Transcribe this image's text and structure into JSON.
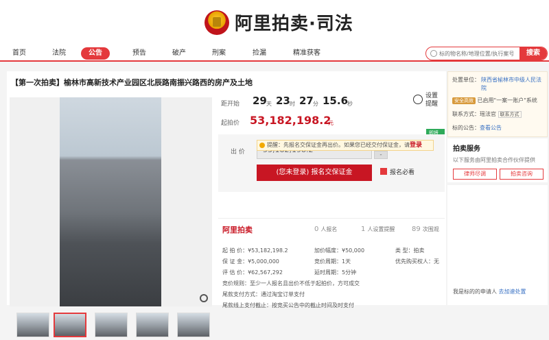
{
  "header": {
    "logo_text": "阿里拍卖·司法"
  },
  "nav": {
    "items": [
      "首页",
      "法院",
      "公告",
      "预告",
      "破产",
      "刑案",
      "捡漏",
      "精准获客"
    ],
    "active": "公告"
  },
  "search": {
    "placeholder": "标的物名称/地理位置/执行案号",
    "button": "搜索"
  },
  "listing": {
    "title": "【第一次拍卖】榆林市高新技术产业园区北辰路南振兴路西的房产及土地",
    "countdown_label": "距开始",
    "days": "29",
    "days_unit": "天",
    "hours": "23",
    "hours_unit": "时",
    "minutes": "27",
    "minutes_unit": "分",
    "seconds": "15.6",
    "seconds_unit": "秒",
    "remind": "设置提醒",
    "start_price_label": "起拍价",
    "start_price": "53,182,198.2",
    "price_unit": "元",
    "status_tag": "即将开始",
    "bid_label": "出  价",
    "bid_value": "53,182,198.2",
    "stepper_plus": "+",
    "stepper_minus": "-",
    "deposit_button": "(您未登录) 报名交保证金",
    "manual_label": "报名必看",
    "notice_text": "提醒：先报名交保证金再出价。如果您已经交付保证金，请",
    "notice_link": "登录"
  },
  "stats": {
    "brand": "阿里拍卖",
    "signups_num": "0",
    "signups_label": "人报名",
    "reminders_num": "1",
    "reminders_label": "人设置提醒",
    "views_num": "89",
    "views_label": "次围观"
  },
  "details": {
    "start_price": "起 拍 价：¥53,182,198.2",
    "increment": "加价幅度：¥50,000",
    "type": "类    型：拍卖",
    "deposit": "保 证 金：¥5,000,000",
    "cycle": "竞价周期：1天",
    "priority": "优先购买权人：无",
    "valuation": "评 估 价：¥62,567,292",
    "delay": "延时周期：5分钟",
    "rule": "竞价规则：至少一人报名且出价不低于起拍价，方可成交",
    "payment": "尾款支付方式：通过淘宝订单支付",
    "deadline": "尾款线上支付截止：按竞买公告中的截止时间及时支付"
  },
  "sidebar": {
    "unit_label": "处置单位：",
    "unit_name": "陕西省榆林市中级人民法院",
    "secure_badge": "安全高效",
    "secure_text": "已启用\"一案一账户\"系统",
    "contact_label": "联系方式：",
    "contact_name": "瑶法官",
    "contact_btn": "联系方式",
    "notice_label": "标的公告：",
    "notice_link": "查看公告",
    "service_title": "拍卖服务",
    "service_desc": "以下服务由阿里拍卖合作伙伴提供",
    "lawyer_btn": "律师尽调",
    "consult_btn": "拍卖咨询",
    "applicant_text": "我是标的的申请人",
    "applicant_link": "去加速处置"
  }
}
